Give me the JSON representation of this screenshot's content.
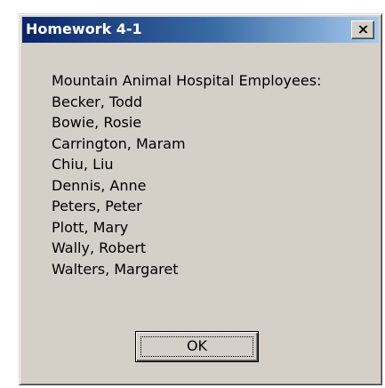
{
  "window": {
    "title": "Homework 4-1"
  },
  "titlebar": {
    "close_icon": "close-icon"
  },
  "message": {
    "heading": "Mountain Animal Hospital Employees:",
    "employees": [
      "Becker, Todd",
      "Bowie, Rosie",
      "Carrington, Maram",
      "Chiu, Liu",
      "Dennis, Anne",
      "Peters, Peter",
      "Plott, Mary",
      "Wally, Robert",
      "Walters, Margaret"
    ]
  },
  "buttons": {
    "ok_label": "OK"
  },
  "colors": {
    "face": "#d4d0c8",
    "title_start": "#0a246a",
    "title_end": "#a6caf0",
    "title_text": "#ffffff"
  }
}
